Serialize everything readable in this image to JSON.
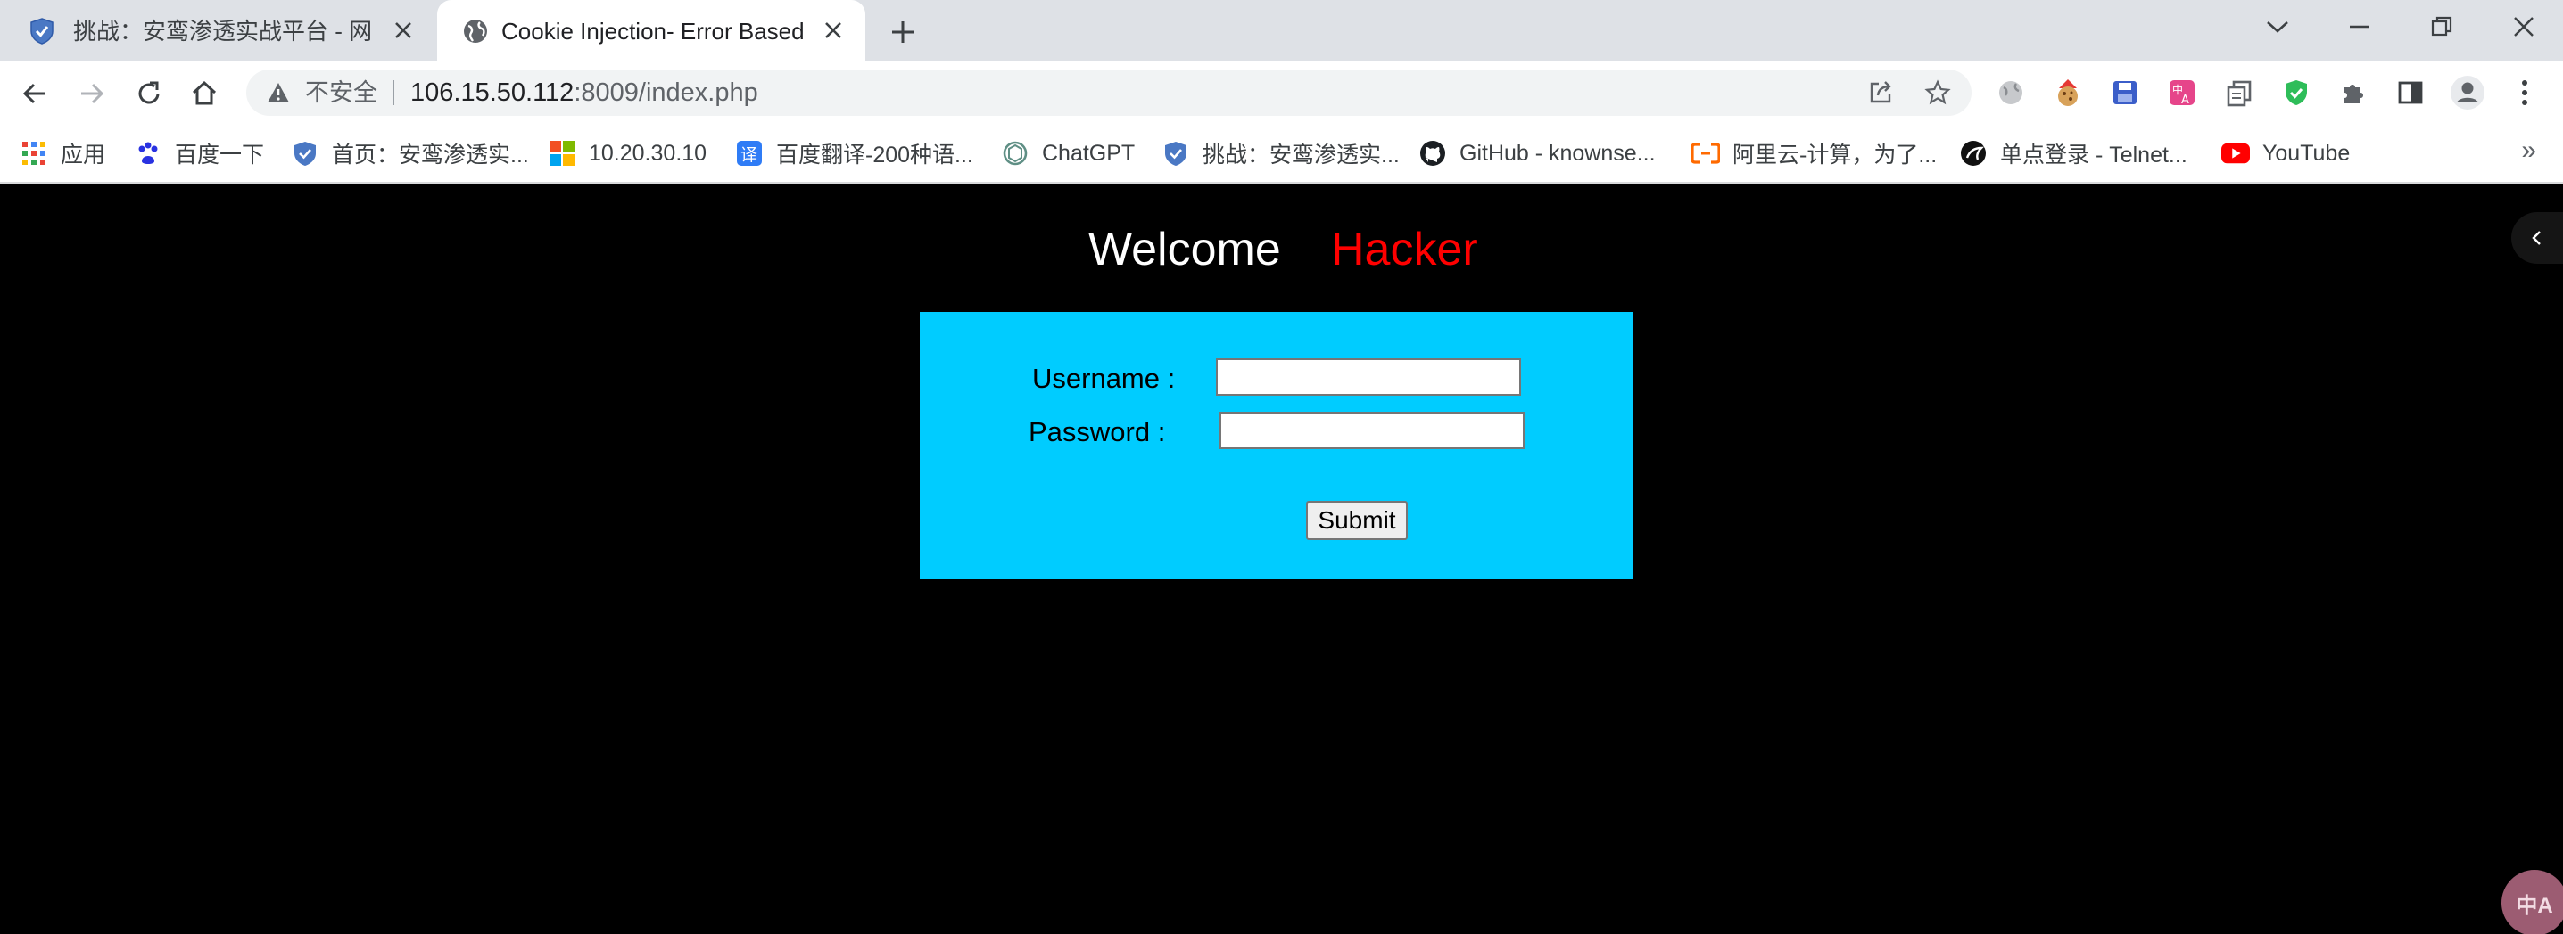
{
  "tabs": [
    {
      "title": "挑战：安鸾渗透实战平台 - 网络安",
      "active": false
    },
    {
      "title": "Cookie Injection- Error Based- ",
      "active": true
    }
  ],
  "omnibox": {
    "insecure_label": "不安全",
    "url_host": "106.15.50.112",
    "url_rest": ":8009/index.php"
  },
  "bookmarks": [
    {
      "label": "应用",
      "icon": "apps-grid-icon"
    },
    {
      "label": "百度一下",
      "icon": "baidu-paw-icon"
    },
    {
      "label": "首页：安鸾渗透实...",
      "icon": "shield-icon"
    },
    {
      "label": "10.20.30.10",
      "icon": "windows-logo-icon"
    },
    {
      "label": "百度翻译-200种语...",
      "icon": "translate-icon"
    },
    {
      "label": "ChatGPT",
      "icon": "chatgpt-icon"
    },
    {
      "label": "挑战：安鸾渗透实...",
      "icon": "shield-icon"
    },
    {
      "label": "GitHub - knownse...",
      "icon": "github-icon"
    },
    {
      "label": "阿里云-计算，为了...",
      "icon": "aliyun-icon"
    },
    {
      "label": "单点登录 - Telnet...",
      "icon": "telnet-icon"
    },
    {
      "label": "YouTube",
      "icon": "youtube-icon"
    }
  ],
  "bookmarks_overflow": "»",
  "page": {
    "welcome": "Welcome",
    "hacker": "Hacker",
    "username_label": "Username :",
    "password_label": "Password :",
    "username_value": "",
    "password_value": "",
    "submit_label": "Submit",
    "translate_bubble": "中A"
  },
  "colors": {
    "page_bg": "#000000",
    "login_box": "#00ccff",
    "hacker_text": "#ff0000",
    "welcome_text": "#ffffff"
  }
}
